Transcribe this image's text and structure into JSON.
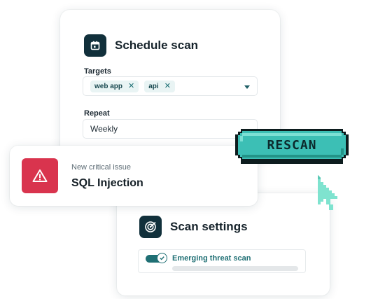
{
  "schedule": {
    "title": "Schedule scan",
    "targets_label": "Targets",
    "targets": [
      "web app",
      "api"
    ],
    "repeat_label": "Repeat",
    "repeat_value": "Weekly"
  },
  "rescan": {
    "label": "RESCAN"
  },
  "alert": {
    "subtitle": "New critical issue",
    "title": "SQL Injection"
  },
  "settings": {
    "title": "Scan settings",
    "option_label": "Emerging threat scan",
    "progress": 0
  },
  "icons": {
    "schedule": "calendar-icon",
    "alert": "warning-triangle-icon",
    "settings": "target-icon",
    "toggle": "check-circle-icon",
    "chip_remove": "close-icon",
    "select": "chevron-down-icon",
    "pointer": "cursor-arrow-icon"
  },
  "colors": {
    "accent": "#1f6f74",
    "dark_icon_bg": "#11303b",
    "alert_red": "#d9344e",
    "rescan_button": "#3cbfb5",
    "cursor": "#7fe3cf"
  }
}
